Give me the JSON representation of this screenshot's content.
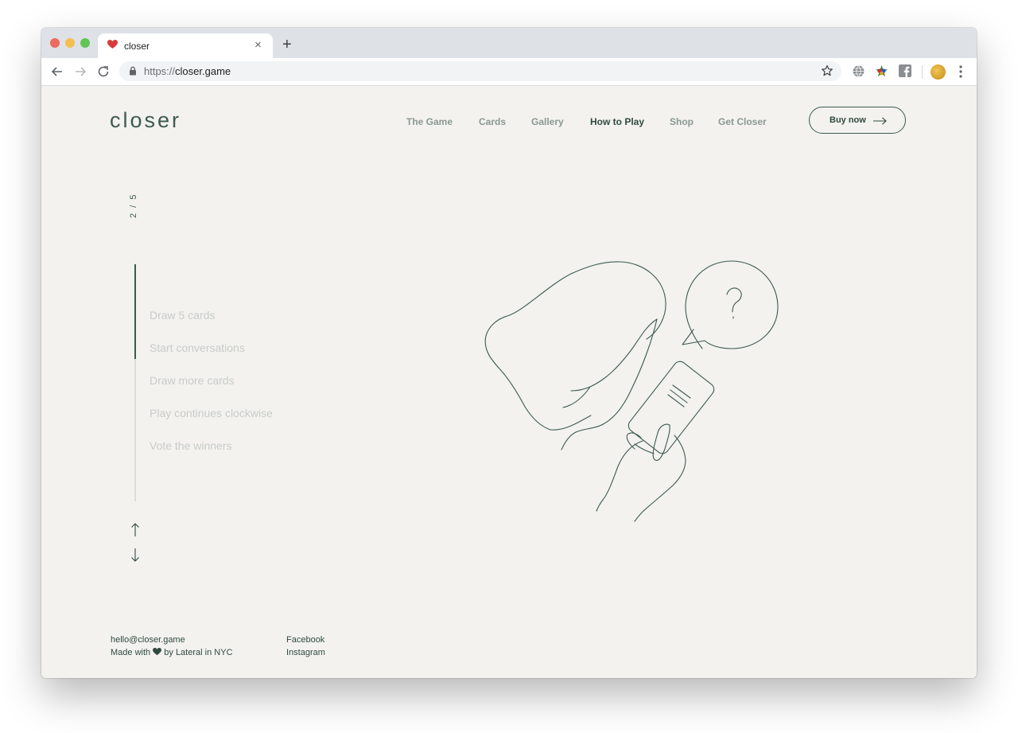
{
  "browser": {
    "tab_title": "closer",
    "new_tab_symbol": "+",
    "tab_close_symbol": "×",
    "url_scheme": "https://",
    "url_host": "closer.game",
    "icons": [
      "back-icon",
      "forward-icon",
      "reload-icon",
      "lock-icon",
      "star-icon",
      "globe-icon",
      "extension-icon",
      "facebook-icon",
      "avatar",
      "menu-icon"
    ]
  },
  "site": {
    "logo": "closer",
    "nav": [
      {
        "label": "The Game"
      },
      {
        "label": "Cards"
      },
      {
        "label": "Gallery"
      },
      {
        "label": "How to Play",
        "active": true
      },
      {
        "label": "Shop"
      },
      {
        "label": "Get Closer"
      }
    ],
    "buy_label": "Buy now",
    "colors": {
      "brand": "#3d5a4e",
      "nav_muted": "#8b9891",
      "step_muted": "#c9ccc8",
      "background": "#f3f2ef"
    }
  },
  "howto": {
    "counter": "2 / 5",
    "progress": 0.4,
    "steps": [
      "Draw 5 cards",
      "Start conversations",
      "Draw more cards",
      "Play continues clockwise",
      "Vote the winners"
    ]
  },
  "footer": {
    "email": "hello@closer.game",
    "made_prefix": "Made with",
    "made_suffix": "by Lateral in NYC",
    "links": [
      "Facebook",
      "Instagram"
    ]
  }
}
